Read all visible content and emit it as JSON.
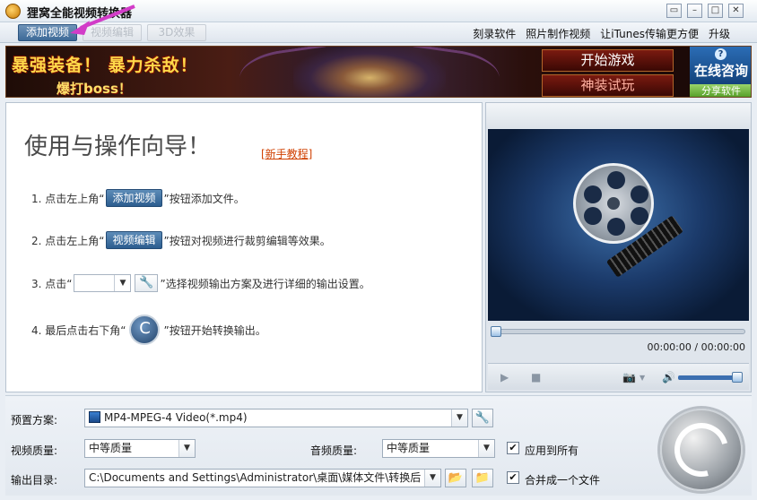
{
  "window": {
    "title": "狸窝全能视频转换器",
    "btn_min": "▭",
    "btn_max": "–",
    "btn_restore": "□",
    "btn_close": "✕"
  },
  "toolbar": {
    "tabs": [
      {
        "label": "添加视频",
        "state": "active"
      },
      {
        "label": "视频编辑",
        "state": "disabled"
      },
      {
        "label": "3D效果",
        "state": "disabled"
      }
    ],
    "links": [
      "刻录软件",
      "照片制作视频",
      "让iTunes传输更方便",
      "升级"
    ]
  },
  "banner": {
    "line1": "暴强装备！ 暴力杀敌！",
    "line2": "爆打boss！",
    "btn_start": "开始游戏",
    "btn_gear": "神装试玩",
    "consult": "在线咨询",
    "consult_badge": "?",
    "share": "分享软件"
  },
  "guide": {
    "title": "使用与操作向导！",
    "tutorial_link": "[新手教程]",
    "steps": [
      {
        "prefix": "1. 点击左上角“",
        "button": "添加视频",
        "suffix": "”按钮添加文件。"
      },
      {
        "prefix": "2. 点击左上角“",
        "button": "视频编辑",
        "suffix": "”按钮对视频进行裁剪编辑等效果。"
      },
      {
        "prefix": "3. 点击“",
        "suffix": "”选择视频输出方案及进行详细的输出设置。"
      },
      {
        "prefix": "4. 最后点击右下角“",
        "suffix": "”按钮开始转换输出。"
      }
    ]
  },
  "preview": {
    "time": "00:00:00 / 00:00:00",
    "seek_progress": 0,
    "volume": 1.0
  },
  "settings": {
    "preset_label": "预置方案:",
    "preset_value": "MP4-MPEG-4 Video(*.mp4)",
    "video_quality_label": "视频质量:",
    "video_quality_value": "中等质量",
    "audio_quality_label": "音频质量:",
    "audio_quality_value": "中等质量",
    "apply_all_label": "应用到所有",
    "apply_all_checked": true,
    "output_label": "输出目录:",
    "output_value": "C:\\Documents and Settings\\Administrator\\桌面\\媒体文件\\转换后",
    "merge_label": "合并成一个文件",
    "merge_checked": true
  },
  "icons": {
    "dropdown": "▼",
    "wrench": "🔧",
    "folder_open": "📂",
    "folder": "📁",
    "check": "✔",
    "play": "▶",
    "stop": "■",
    "camera": "📷",
    "speaker": "🔊",
    "convert": "C"
  },
  "colors": {
    "accent_button": "#2c5d8f",
    "annotation_arrow": "#d23cc8",
    "link": "#d04000"
  }
}
